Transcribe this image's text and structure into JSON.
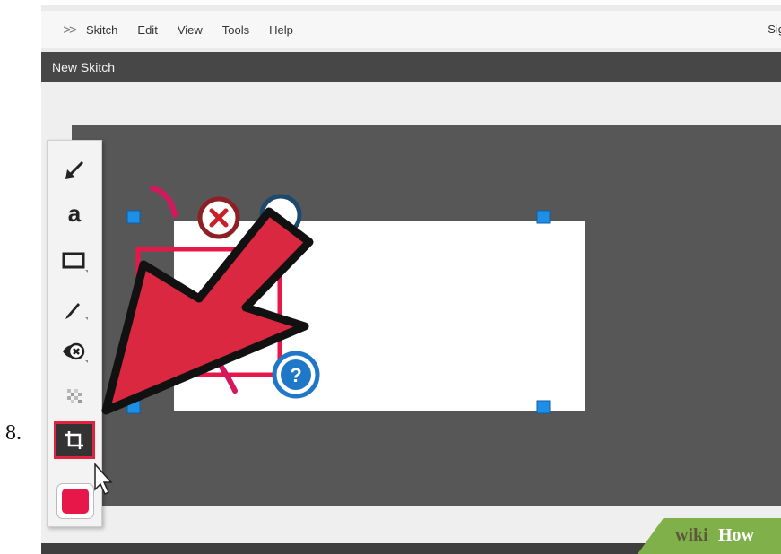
{
  "step_number": "8.",
  "menu": {
    "logo_icon": "skitch-logo-icon",
    "items": [
      "Skitch",
      "Edit",
      "View",
      "Tools",
      "Help"
    ],
    "signin_partial": "Sig"
  },
  "window_title": "New Skitch",
  "toolbar": {
    "tools": [
      {
        "name": "arrow-tool",
        "icon": "arrow-icon"
      },
      {
        "name": "text-tool",
        "icon": "text-icon",
        "glyph": "a"
      },
      {
        "name": "shape-tool",
        "icon": "rectangle-icon"
      },
      {
        "name": "pen-tool",
        "icon": "pen-icon"
      },
      {
        "name": "stamp-tool",
        "icon": "stamp-icon"
      },
      {
        "name": "pixelate-tool",
        "icon": "pixelate-icon"
      },
      {
        "name": "crop-tool",
        "icon": "crop-icon",
        "active": true
      }
    ],
    "selected_color": "#e8174a"
  },
  "canvas_stamps": [
    "x-stamp",
    "check-stamp",
    "question-stamp"
  ],
  "question_stamp_label": "?",
  "colors": {
    "annotation_red": "#d9283f",
    "handle_blue": "#1e8fe6",
    "canvas_gray": "#575757",
    "titlebar_gray": "#474747"
  },
  "watermark": {
    "prefix": "wiki",
    "suffix": "How"
  }
}
